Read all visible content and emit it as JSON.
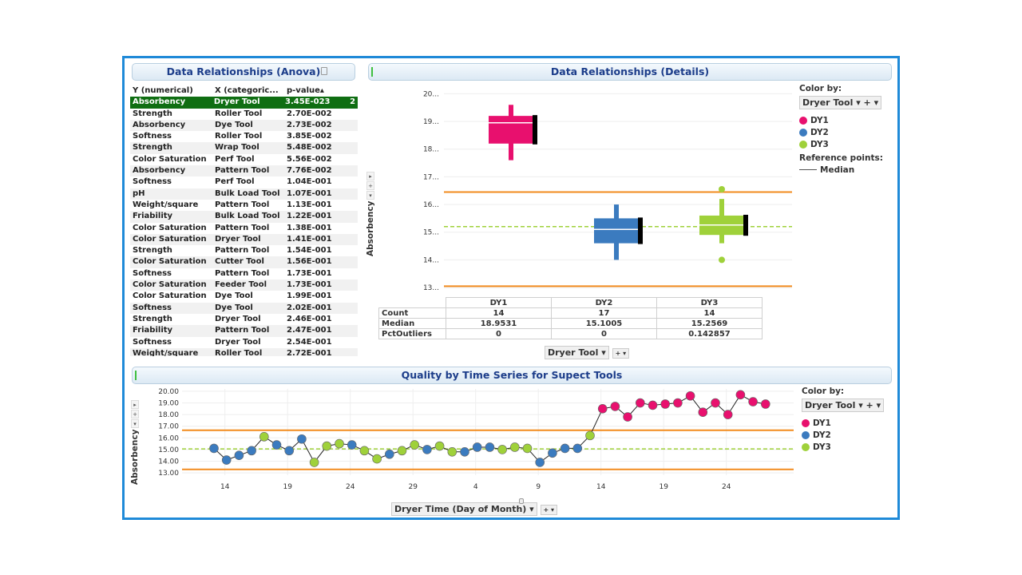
{
  "panels": {
    "anova_title": "Data Relationships (Anova)",
    "details_title": "Data Relationships (Details)",
    "ts_title": "Quality by Time Series for Supect Tools"
  },
  "anova": {
    "columns": [
      "Y (numerical)",
      "X (categoric...",
      "p-value▴"
    ],
    "rows": [
      [
        "Absorbency",
        "Dryer Tool",
        "3.45E-023"
      ],
      [
        "Strength",
        "Roller Tool",
        "2.70E-002"
      ],
      [
        "Absorbency",
        "Dye Tool",
        "2.73E-002"
      ],
      [
        "Softness",
        "Roller Tool",
        "3.85E-002"
      ],
      [
        "Strength",
        "Wrap Tool",
        "5.48E-002"
      ],
      [
        "Color Saturation",
        "Perf Tool",
        "5.56E-002"
      ],
      [
        "Absorbency",
        "Pattern Tool",
        "7.76E-002"
      ],
      [
        "Softness",
        "Perf Tool",
        "1.04E-001"
      ],
      [
        "pH",
        "Bulk Load Tool",
        "1.07E-001"
      ],
      [
        "Weight/square",
        "Pattern Tool",
        "1.13E-001"
      ],
      [
        "Friability",
        "Bulk Load Tool",
        "1.22E-001"
      ],
      [
        "Color Saturation",
        "Pattern Tool",
        "1.38E-001"
      ],
      [
        "Color Saturation",
        "Dryer Tool",
        "1.41E-001"
      ],
      [
        "Strength",
        "Pattern Tool",
        "1.54E-001"
      ],
      [
        "Color Saturation",
        "Cutter Tool",
        "1.56E-001"
      ],
      [
        "Softness",
        "Pattern Tool",
        "1.73E-001"
      ],
      [
        "Color Saturation",
        "Feeder Tool",
        "1.73E-001"
      ],
      [
        "Color Saturation",
        "Dye Tool",
        "1.99E-001"
      ],
      [
        "Softness",
        "Dye Tool",
        "2.02E-001"
      ],
      [
        "Strength",
        "Dryer Tool",
        "2.46E-001"
      ],
      [
        "Friability",
        "Pattern Tool",
        "2.47E-001"
      ],
      [
        "Softness",
        "Dryer Tool",
        "2.54E-001"
      ],
      [
        "Weight/square",
        "Roller Tool",
        "2.72E-001"
      ]
    ],
    "selected_extra": "2"
  },
  "details": {
    "ylabel": "Absorbency",
    "legend_title": "Color by:",
    "legend_dropdown": "Dryer Tool",
    "legend_items": [
      "DY1",
      "DY2",
      "DY3"
    ],
    "ref_title": "Reference points:",
    "ref_median": "Median",
    "xaxis_dropdown": "Dryer Tool",
    "stats_headers": [
      "DY1",
      "DY2",
      "DY3"
    ],
    "stats_rows": [
      {
        "label": "Count",
        "values": [
          "14",
          "17",
          "14"
        ]
      },
      {
        "label": "Median",
        "values": [
          "18.9531",
          "15.1005",
          "15.2569"
        ]
      },
      {
        "label": "PctOutliers",
        "values": [
          "0",
          "0",
          "0.142857"
        ]
      }
    ]
  },
  "timeseries": {
    "ylabel": "Absorbency",
    "legend_title": "Color by:",
    "legend_dropdown": "Dryer Tool",
    "legend_items": [
      "DY1",
      "DY2",
      "DY3"
    ],
    "xaxis_dropdown": "Dryer Time (Day of Month)"
  },
  "colors": {
    "DY1": "#e8106e",
    "DY2": "#3b7bbf",
    "DY3": "#9fd13a",
    "limit": "#f28b1e",
    "mean": "#9fd13a",
    "accent": "#1f8ad8"
  },
  "chart_data": [
    {
      "type": "box",
      "ylabel": "Absorbency",
      "ylim": [
        12.8,
        20.3
      ],
      "yticks": [
        "13...",
        "14...",
        "15...",
        "16...",
        "17...",
        "18...",
        "19...",
        "20..."
      ],
      "categories": [
        "DY1",
        "DY2",
        "DY3"
      ],
      "boxes": [
        {
          "name": "DY1",
          "min": 17.6,
          "q1": 18.2,
          "median": 18.95,
          "q3": 19.2,
          "max": 19.6,
          "outliers": []
        },
        {
          "name": "DY2",
          "min": 14.0,
          "q1": 14.6,
          "median": 15.1,
          "q3": 15.5,
          "max": 16.0,
          "outliers": []
        },
        {
          "name": "DY3",
          "min": 14.6,
          "q1": 14.9,
          "median": 15.26,
          "q3": 15.6,
          "max": 16.2,
          "outliers": [
            16.55,
            14.0
          ]
        }
      ],
      "ref_lines": {
        "upper_limit": 16.45,
        "lower_limit": 13.05,
        "mean": 15.2
      }
    },
    {
      "type": "line",
      "ylabel": "Absorbency",
      "xlabel": "Dryer Time (Day of Month)",
      "ylim": [
        12.8,
        20.2
      ],
      "yticks": [
        "13.00",
        "14.00",
        "15.00",
        "16.00",
        "17.00",
        "18.00",
        "19.00",
        "20.00"
      ],
      "xticks": [
        "14",
        "19",
        "24",
        "29",
        "4",
        "9",
        "14",
        "19",
        "24"
      ],
      "series_points": [
        {
          "t": 0,
          "y": 15.1,
          "g": "DY2"
        },
        {
          "t": 1,
          "y": 14.1,
          "g": "DY2"
        },
        {
          "t": 2,
          "y": 14.5,
          "g": "DY2"
        },
        {
          "t": 3,
          "y": 14.9,
          "g": "DY2"
        },
        {
          "t": 4,
          "y": 16.1,
          "g": "DY3"
        },
        {
          "t": 5,
          "y": 15.4,
          "g": "DY2"
        },
        {
          "t": 6,
          "y": 14.9,
          "g": "DY2"
        },
        {
          "t": 7,
          "y": 15.9,
          "g": "DY2"
        },
        {
          "t": 8,
          "y": 13.9,
          "g": "DY3"
        },
        {
          "t": 9,
          "y": 15.3,
          "g": "DY3"
        },
        {
          "t": 10,
          "y": 15.5,
          "g": "DY3"
        },
        {
          "t": 11,
          "y": 15.4,
          "g": "DY2"
        },
        {
          "t": 12,
          "y": 14.9,
          "g": "DY3"
        },
        {
          "t": 13,
          "y": 14.2,
          "g": "DY3"
        },
        {
          "t": 14,
          "y": 14.6,
          "g": "DY2"
        },
        {
          "t": 15,
          "y": 14.9,
          "g": "DY3"
        },
        {
          "t": 16,
          "y": 15.4,
          "g": "DY3"
        },
        {
          "t": 17,
          "y": 15.0,
          "g": "DY2"
        },
        {
          "t": 18,
          "y": 15.3,
          "g": "DY3"
        },
        {
          "t": 19,
          "y": 14.8,
          "g": "DY3"
        },
        {
          "t": 20,
          "y": 14.8,
          "g": "DY2"
        },
        {
          "t": 21,
          "y": 15.2,
          "g": "DY2"
        },
        {
          "t": 22,
          "y": 15.2,
          "g": "DY2"
        },
        {
          "t": 23,
          "y": 15.0,
          "g": "DY3"
        },
        {
          "t": 24,
          "y": 15.2,
          "g": "DY3"
        },
        {
          "t": 25,
          "y": 15.1,
          "g": "DY3"
        },
        {
          "t": 26,
          "y": 13.9,
          "g": "DY2"
        },
        {
          "t": 27,
          "y": 14.7,
          "g": "DY2"
        },
        {
          "t": 28,
          "y": 15.1,
          "g": "DY2"
        },
        {
          "t": 29,
          "y": 15.1,
          "g": "DY2"
        },
        {
          "t": 30,
          "y": 16.2,
          "g": "DY3"
        },
        {
          "t": 31,
          "y": 18.5,
          "g": "DY1"
        },
        {
          "t": 32,
          "y": 18.7,
          "g": "DY1"
        },
        {
          "t": 33,
          "y": 17.8,
          "g": "DY1"
        },
        {
          "t": 34,
          "y": 19.0,
          "g": "DY1"
        },
        {
          "t": 35,
          "y": 18.8,
          "g": "DY1"
        },
        {
          "t": 36,
          "y": 18.9,
          "g": "DY1"
        },
        {
          "t": 37,
          "y": 19.0,
          "g": "DY1"
        },
        {
          "t": 38,
          "y": 19.6,
          "g": "DY1"
        },
        {
          "t": 39,
          "y": 18.2,
          "g": "DY1"
        },
        {
          "t": 40,
          "y": 19.0,
          "g": "DY1"
        },
        {
          "t": 41,
          "y": 18.0,
          "g": "DY1"
        },
        {
          "t": 42,
          "y": 19.7,
          "g": "DY1"
        },
        {
          "t": 43,
          "y": 19.1,
          "g": "DY1"
        },
        {
          "t": 44,
          "y": 18.9,
          "g": "DY1"
        }
      ],
      "ref_lines": {
        "upper_limit": 16.65,
        "lower_limit": 13.3,
        "mean": 15.05
      }
    }
  ]
}
